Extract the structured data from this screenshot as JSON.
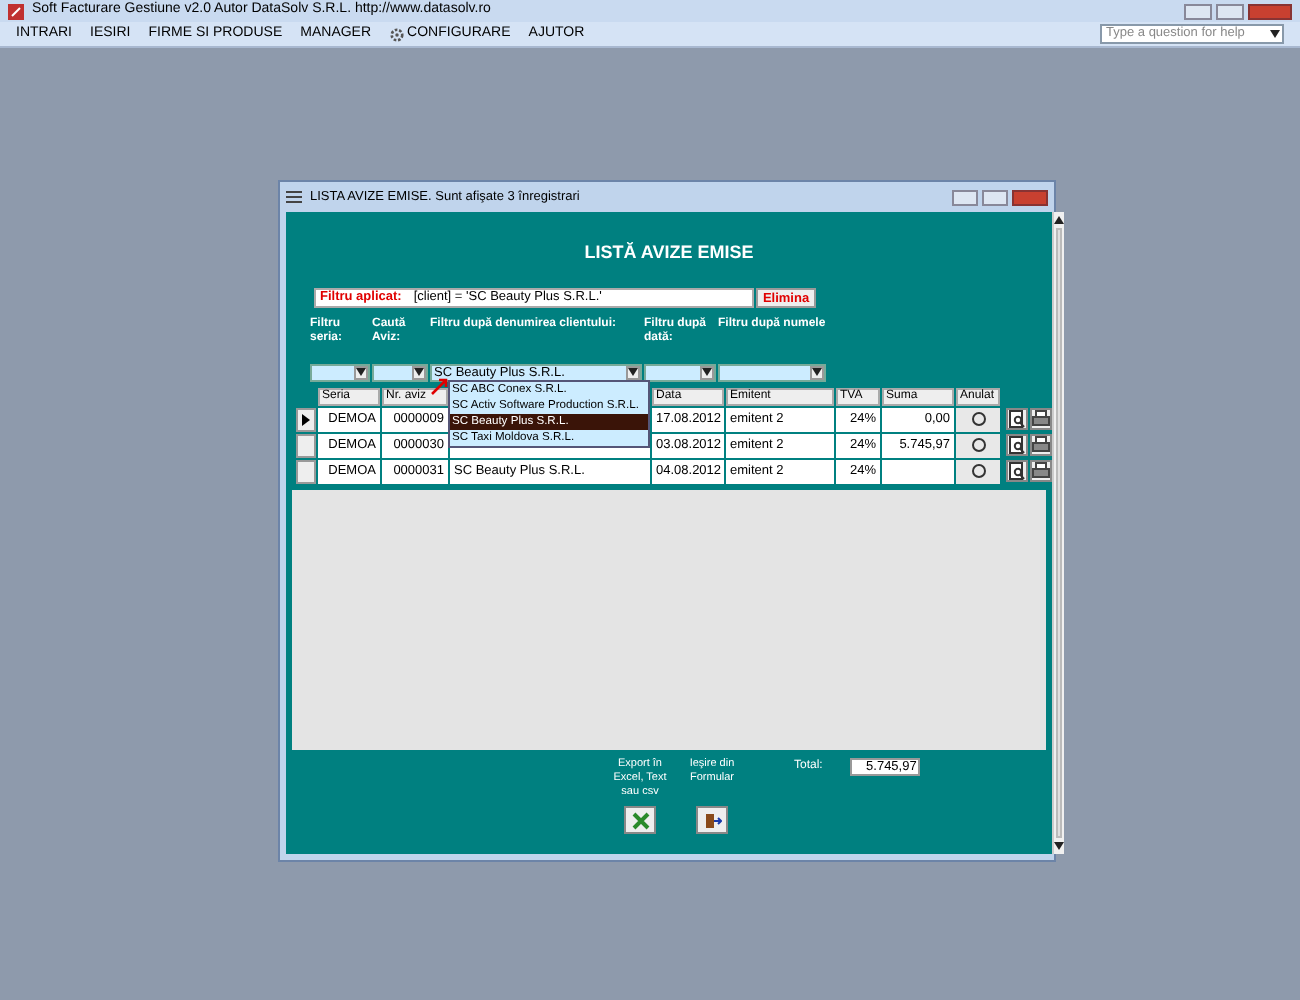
{
  "app_title": "Soft Facturare Gestiune v2.0 Autor DataSolv S.R.L. http://www.datasolv.ro",
  "menu": [
    {
      "label": "INTRARI",
      "icon": false
    },
    {
      "label": "IESIRI",
      "icon": false
    },
    {
      "label": "FIRME SI PRODUSE",
      "icon": false
    },
    {
      "label": "MANAGER",
      "icon": false
    },
    {
      "label": "CONFIGURARE",
      "icon": true
    },
    {
      "label": "AJUTOR",
      "icon": false
    }
  ],
  "help_search": {
    "placeholder": "Type a question for help"
  },
  "window": {
    "title": "LISTA AVIZE EMISE. Sunt afişate 3 înregistrari",
    "heading": "LISTĂ AVIZE EMISE",
    "filter": {
      "label": "Filtru aplicat:",
      "value": "[client] = 'SC Beauty Plus S.R.L.'",
      "button": "Elimina"
    },
    "filters": [
      {
        "label": "Filtru seria:"
      },
      {
        "label": "Caută Aviz:"
      },
      {
        "label": "Filtru după denumirea clientului:",
        "value": "SC Beauty Plus S.R.L."
      },
      {
        "label": "Filtru după dată:"
      },
      {
        "label": "Filtru după numele"
      }
    ],
    "dropdown": [
      {
        "label": "SC ABC Conex S.R.L.",
        "selected": false
      },
      {
        "label": "SC Activ Software Production S.R.L.",
        "selected": false
      },
      {
        "label": "SC Beauty Plus S.R.L.",
        "selected": true
      },
      {
        "label": "SC Taxi Moldova S.R.L.",
        "selected": false
      }
    ],
    "columns": [
      "Seria",
      "Nr. aviz",
      "",
      "Data",
      "Emitent",
      "TVA",
      "Suma",
      "Anulat"
    ],
    "rows": [
      {
        "current": true,
        "seria": "DEMOA",
        "nr": "0000009",
        "data": "17.08.2012",
        "emitent": "emitent 2",
        "tva": "24%",
        "suma": "0,00",
        "anulat": false
      },
      {
        "current": false,
        "seria": "DEMOA",
        "nr": "0000030",
        "data": "03.08.2012",
        "emitent": "emitent 2",
        "tva": "24%",
        "suma": "5.745,97",
        "anulat": false
      },
      {
        "current": false,
        "seria": "DEMOA",
        "nr": "0000031",
        "client": "SC Beauty Plus S.R.L.",
        "data": "04.08.2012",
        "emitent": "emitent 2",
        "tva": "24%",
        "suma": "",
        "anulat": false
      }
    ],
    "export_label": "Export în Excel, Text sau csv",
    "exit_label": "Ieşire din Formular",
    "total_label": "Total:",
    "total_value": "5.745,97"
  }
}
